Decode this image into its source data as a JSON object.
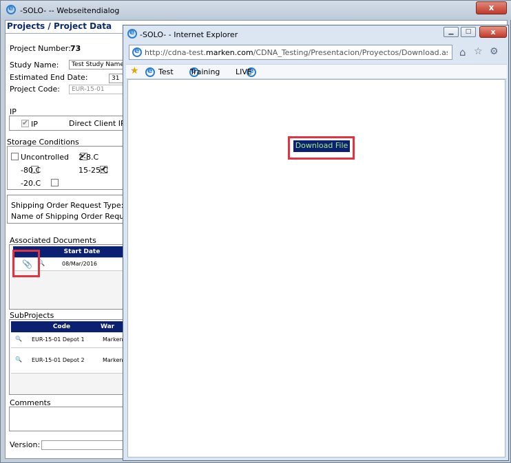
{
  "outer_window": {
    "title": "-SOLO- -- Webseitendialog",
    "close_glyph": "x"
  },
  "project": {
    "heading": "Projects / Project Data",
    "number_label": "Project Number:",
    "number_value": "73",
    "study_name_label": "Study Name:",
    "study_name_value": "Test Study Name",
    "end_date_label": "Estimated End Date:",
    "end_date_value": "31",
    "code_label": "Project Code:",
    "code_value": "EUR-15-01"
  },
  "ip": {
    "section_label": "IP",
    "checkbox_label": "IP",
    "checked": true,
    "direct_client_label": "Direct Client IP:"
  },
  "storage": {
    "section_label": "Storage Conditions",
    "options": [
      {
        "label": "Uncontrolled",
        "checked": false
      },
      {
        "label": "2-8.C",
        "checked": true
      },
      {
        "label": "-80.C",
        "checked": false
      },
      {
        "label": "15-25.C",
        "checked": true
      },
      {
        "label": "-20.C",
        "checked": false
      }
    ]
  },
  "shipping": {
    "type_label": "Shipping Order Request Type:",
    "name_label": "Name of Shipping Order Request"
  },
  "documents": {
    "section_label": "Associated Documents",
    "header_start_date": "Start Date",
    "rows": [
      {
        "start_date": "08/Mar/2016",
        "attach_icon": "paperclip-icon",
        "view_icon": "magnifier-icon"
      }
    ]
  },
  "subprojects": {
    "section_label": "SubProjects",
    "headers": {
      "code": "Code",
      "warehouse": "War"
    },
    "rows": [
      {
        "code": "EUR-15-01 Depot 1",
        "warehouse": "Marken"
      },
      {
        "code": "EUR-15-01 Depot 2",
        "warehouse": "Marken"
      }
    ]
  },
  "comments": {
    "label": "Comments"
  },
  "version": {
    "label": "Version:"
  },
  "ie_window": {
    "title": "-SOLO- - Internet Explorer",
    "address_prefix": "http://cdna-test.",
    "address_domain": "marken.com",
    "address_rest": "/CDNA_Testing/Presentacion/Proyectos/Download.aspx?docur",
    "favorites": [
      {
        "label": "Test"
      },
      {
        "label": "Training"
      },
      {
        "label": "LIVE"
      }
    ],
    "download_button": "Download File",
    "icons": {
      "home": "home-icon",
      "favorites": "star-icon",
      "tools": "gear-icon"
    }
  },
  "colors": {
    "header_navy": "#0b2070",
    "highlight_red": "#e33240",
    "download_text": "#9df27a"
  }
}
